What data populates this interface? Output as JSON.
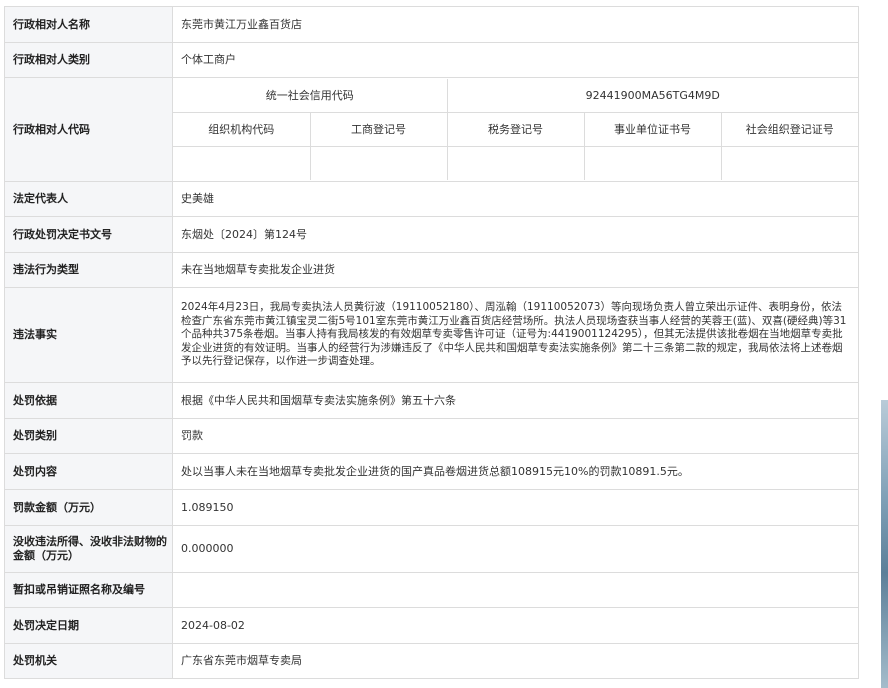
{
  "rows": [
    {
      "label": "行政相对人名称",
      "value": "东莞市黄江万业鑫百货店"
    },
    {
      "label": "行政相对人类别",
      "value": "个体工商户"
    },
    {
      "label": "行政相对人代码"
    },
    {
      "label": "法定代表人",
      "value": "史美雄"
    },
    {
      "label": "行政处罚决定书文号",
      "value": "东烟处〔2024〕第124号"
    },
    {
      "label": "违法行为类型",
      "value": "未在当地烟草专卖批发企业进货"
    },
    {
      "label": "违法事实",
      "value": "2024年4月23日，我局专卖执法人员黄衍波（19110052180）、周泓翰（19110052073）等向现场负责人曾立荣出示证件、表明身份，依法检查广东省东莞市黄江镇宝灵二街5号101室东莞市黄江万业鑫百货店经营场所。执法人员现场查获当事人经营的芙蓉王(蓝)、双喜(硬经典)等31个品种共375条卷烟。当事人持有我局核发的有效烟草专卖零售许可证（证号为:4419001124295），但其无法提供该批卷烟在当地烟草专卖批发企业进货的有效证明。当事人的经营行为涉嫌违反了《中华人民共和国烟草专卖法实施条例》第二十三条第二款的规定，我局依法将上述卷烟予以先行登记保存，以作进一步调查处理。"
    },
    {
      "label": "处罚依据",
      "value": "根据《中华人民共和国烟草专卖法实施条例》第五十六条"
    },
    {
      "label": "处罚类别",
      "value": "罚款"
    },
    {
      "label": "处罚内容",
      "value": "处以当事人未在当地烟草专卖批发企业进货的国产真品卷烟进货总额108915元10%的罚款10891.5元。"
    },
    {
      "label": "罚款金额（万元）",
      "value": "1.089150"
    },
    {
      "label": "没收违法所得、没收非法财物的金额（万元）",
      "value": "0.000000"
    },
    {
      "label": "暂扣或吊销证照名称及编号",
      "value": ""
    },
    {
      "label": "处罚决定日期",
      "value": "2024-08-02"
    },
    {
      "label": "处罚机关",
      "value": "广东省东莞市烟草专卖局"
    }
  ],
  "codes": {
    "uscc_label": "统一社会信用代码",
    "uscc_value": "92441900MA56TG4M9D",
    "headers": [
      "组织机构代码",
      "工商登记号",
      "税务登记号",
      "事业单位证书号",
      "社会组织登记证号"
    ],
    "values": [
      "",
      "",
      "",
      "",
      ""
    ]
  }
}
